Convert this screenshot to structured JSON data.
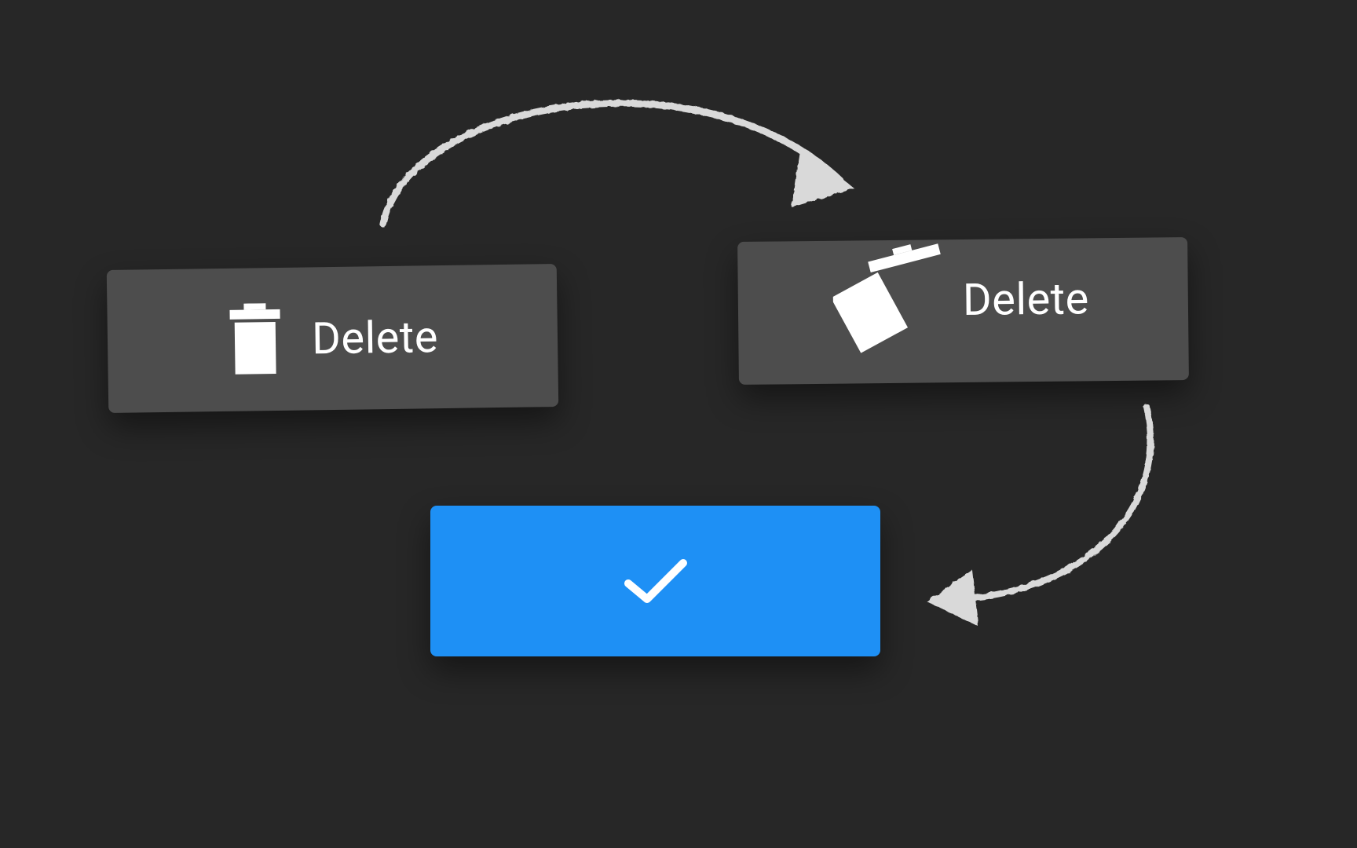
{
  "buttons": {
    "delete_normal": {
      "label": "Delete"
    },
    "delete_hover": {
      "label": "Delete"
    }
  },
  "colors": {
    "bg": "#272727",
    "button_dark": "#4d4d4d",
    "button_blue": "#1e90f5",
    "text": "#ffffff",
    "arrow": "#d9d9d9"
  }
}
